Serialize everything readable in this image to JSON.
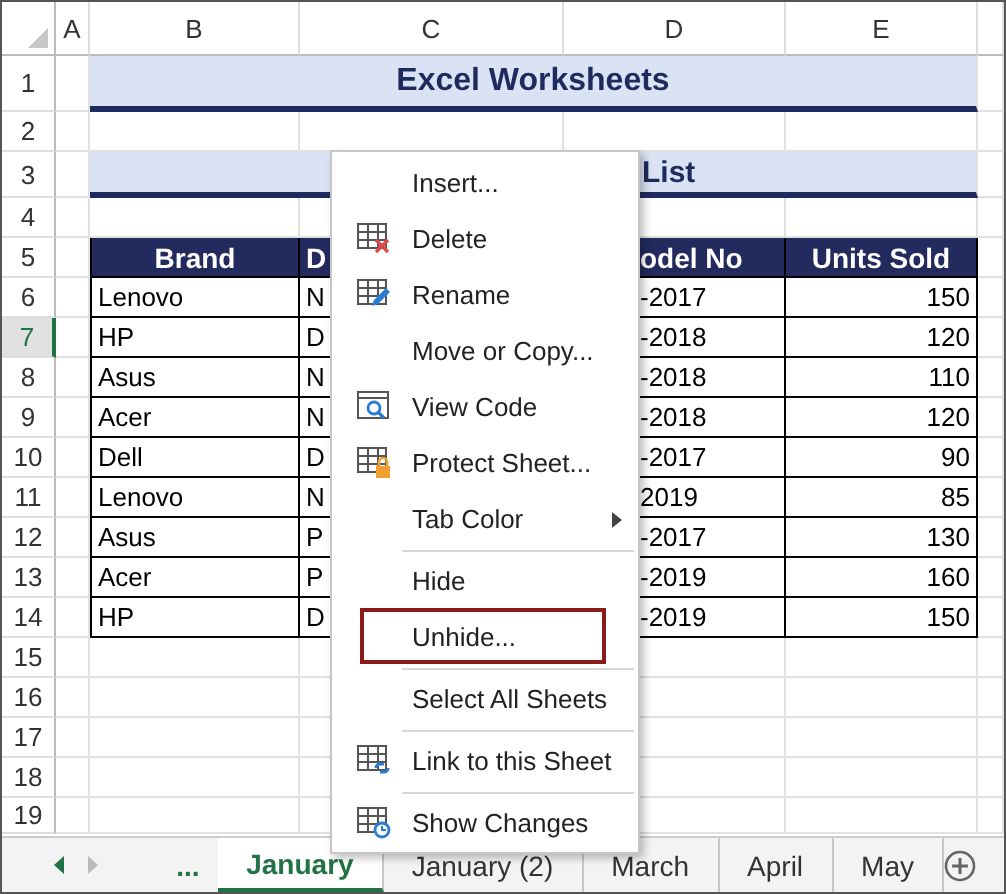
{
  "columns": [
    "A",
    "B",
    "C",
    "D",
    "E"
  ],
  "rows": [
    {
      "label": "1",
      "selected": false
    },
    {
      "label": "2",
      "selected": false
    },
    {
      "label": "3",
      "selected": false
    },
    {
      "label": "4",
      "selected": false
    },
    {
      "label": "5",
      "selected": false
    },
    {
      "label": "6",
      "selected": false
    },
    {
      "label": "7",
      "selected": true
    },
    {
      "label": "8",
      "selected": false
    },
    {
      "label": "9",
      "selected": false
    },
    {
      "label": "10",
      "selected": false
    },
    {
      "label": "11",
      "selected": false
    },
    {
      "label": "12",
      "selected": false
    },
    {
      "label": "13",
      "selected": false
    },
    {
      "label": "14",
      "selected": false
    },
    {
      "label": "15",
      "selected": false
    },
    {
      "label": "16",
      "selected": false
    },
    {
      "label": "17",
      "selected": false
    },
    {
      "label": "18",
      "selected": false
    },
    {
      "label": "19",
      "selected": false
    }
  ],
  "title": "Excel Worksheets",
  "subtitle": "List",
  "table": {
    "columns": [
      "Brand",
      "D",
      "odel No",
      "Units Sold"
    ],
    "rows": [
      [
        "Lenovo",
        "N",
        "-2017",
        "150"
      ],
      [
        "HP",
        "D",
        "-2018",
        "120"
      ],
      [
        "Asus",
        "N",
        "-2018",
        "110"
      ],
      [
        "Acer",
        "N",
        "-2018",
        "120"
      ],
      [
        "Dell",
        "D",
        "-2017",
        "90"
      ],
      [
        "Lenovo",
        "N",
        "2019",
        "85"
      ],
      [
        "Asus",
        "P",
        "-2017",
        "130"
      ],
      [
        "Acer",
        "P",
        "-2019",
        "160"
      ],
      [
        "HP",
        "D",
        "-2019",
        "150"
      ]
    ]
  },
  "context_menu": {
    "items": [
      {
        "label": "Insert...",
        "kind": "plain",
        "submenu": false,
        "highlighted": false,
        "separator_before": false
      },
      {
        "label": "Delete",
        "kind": "delete",
        "submenu": false,
        "highlighted": false,
        "separator_before": false
      },
      {
        "label": "Rename",
        "kind": "rename",
        "submenu": false,
        "highlighted": false,
        "separator_before": false
      },
      {
        "label": "Move or Copy...",
        "kind": "plain",
        "submenu": false,
        "highlighted": false,
        "separator_before": false
      },
      {
        "label": "View Code",
        "kind": "code",
        "submenu": false,
        "highlighted": false,
        "separator_before": false
      },
      {
        "label": "Protect Sheet...",
        "kind": "protect",
        "submenu": false,
        "highlighted": false,
        "separator_before": false
      },
      {
        "label": "Tab Color",
        "kind": "plain",
        "submenu": true,
        "highlighted": false,
        "separator_before": false
      },
      {
        "label": "Hide",
        "kind": "plain",
        "submenu": false,
        "highlighted": false,
        "separator_before": true
      },
      {
        "label": "Unhide...",
        "kind": "plain",
        "submenu": false,
        "highlighted": true,
        "separator_before": false
      },
      {
        "label": "Select All Sheets",
        "kind": "plain",
        "submenu": false,
        "highlighted": false,
        "separator_before": true
      },
      {
        "label": "Link to this Sheet",
        "kind": "link",
        "submenu": false,
        "highlighted": false,
        "separator_before": true
      },
      {
        "label": "Show Changes",
        "kind": "changes",
        "submenu": false,
        "highlighted": false,
        "separator_before": true
      }
    ]
  },
  "sheet_tabs": {
    "overflow": "...",
    "tabs": [
      {
        "label": "January",
        "selected": true
      },
      {
        "label": "January (2)",
        "selected": false
      },
      {
        "label": "March",
        "selected": false
      },
      {
        "label": "April",
        "selected": false
      },
      {
        "label": "May",
        "selected": false
      }
    ]
  }
}
